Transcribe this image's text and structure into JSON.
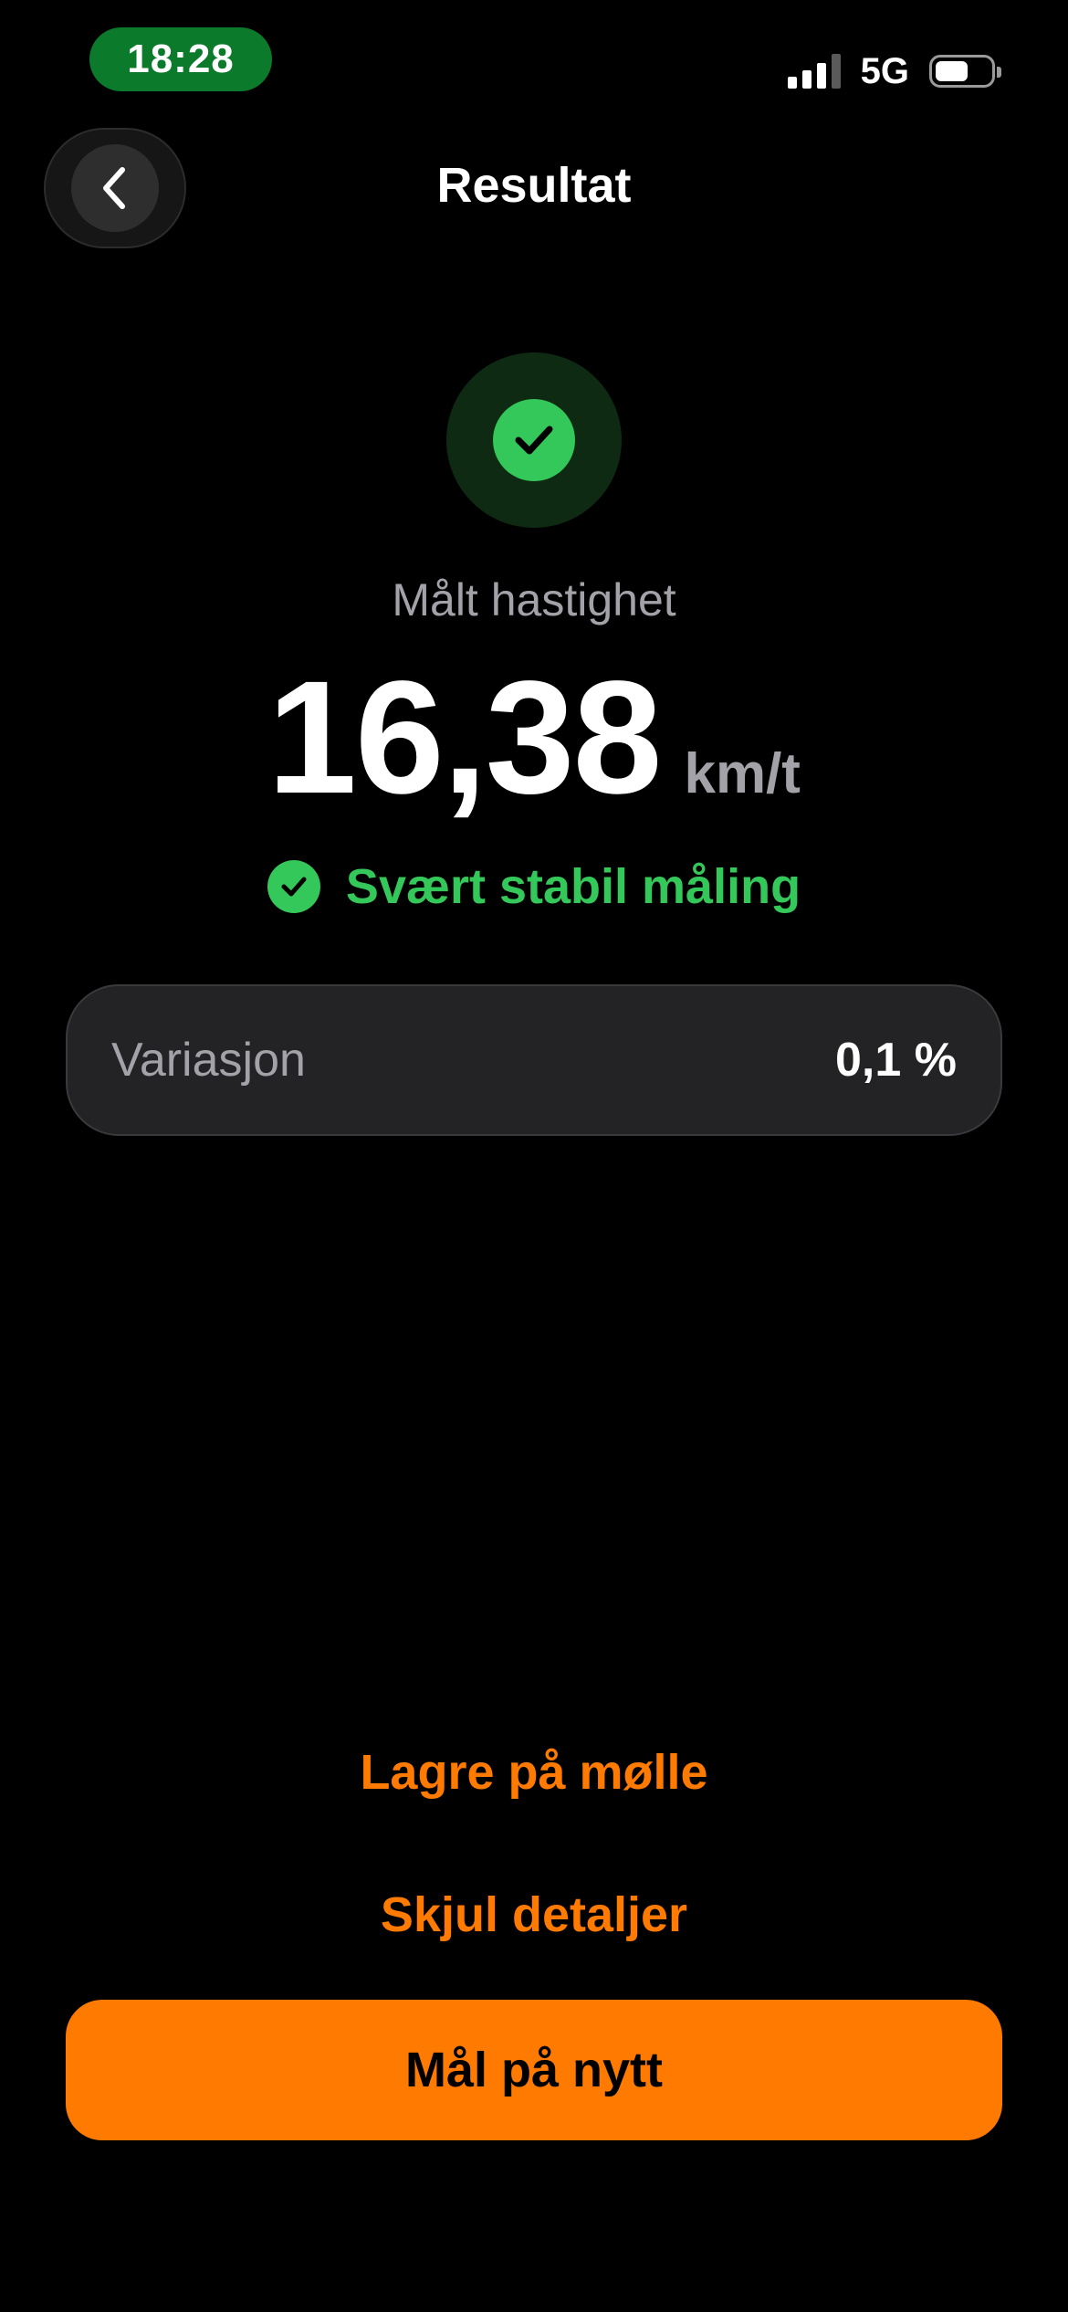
{
  "status_bar": {
    "time": "18:28",
    "network": "5G",
    "battery_level": 0.6,
    "signal_bars_active": 3,
    "signal_bars_total": 4
  },
  "nav": {
    "title": "Resultat",
    "back_icon": "chevron-left-icon"
  },
  "result": {
    "status_icon": "checkmark-icon",
    "label": "Målt hastighet",
    "value": "16,38",
    "unit": "km/t",
    "stability_icon": "checkmark-circle-icon",
    "stability_text": "Svært stabil måling"
  },
  "variation": {
    "label": "Variasjon",
    "value": "0,1 %"
  },
  "actions": {
    "save_label": "Lagre på mølle",
    "hide_details_label": "Skjul detaljer",
    "remeasure_label": "Mål på nytt"
  },
  "colors": {
    "accent": "#ff7a00",
    "success": "#34c759",
    "background": "#000000",
    "card": "#232325",
    "status_pill": "#0b7a2b"
  }
}
